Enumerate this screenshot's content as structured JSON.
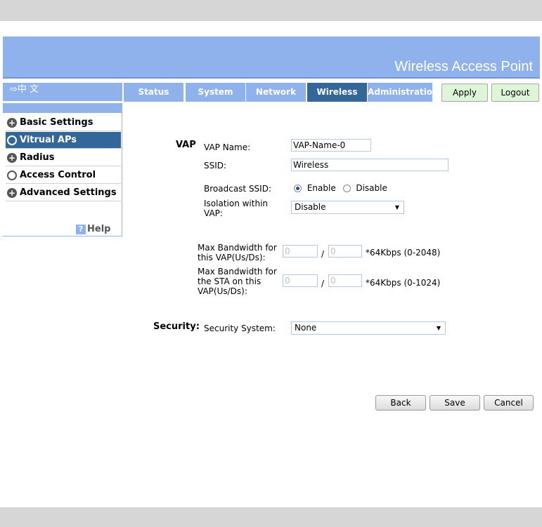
{
  "header": {
    "title": "Wireless Access Point",
    "lang_toggle": "⇨中 文"
  },
  "tabs": [
    {
      "label": "Status"
    },
    {
      "label": "System"
    },
    {
      "label": "Network"
    },
    {
      "label": "Wireless"
    },
    {
      "label": "Administration"
    }
  ],
  "actions": {
    "apply": "Apply",
    "logout": "Logout"
  },
  "sidebar": {
    "items": [
      {
        "label": "Basic Settings",
        "icon": "plus-icon"
      },
      {
        "label": "Vitrual APs",
        "icon": "circle-icon"
      },
      {
        "label": "Radius",
        "icon": "plus-icon"
      },
      {
        "label": "Access Control",
        "icon": "circle-icon"
      },
      {
        "label": "Advanced Settings",
        "icon": "plus-icon"
      }
    ],
    "help": "Help"
  },
  "vap": {
    "section": "VAP",
    "name_label": "VAP Name:",
    "name_value": "VAP-Name-0",
    "ssid_label": "SSID:",
    "ssid_value": "Wireless",
    "broadcast_label": "Broadcast SSID:",
    "broadcast_enable": "Enable",
    "broadcast_disable": "Disable",
    "isolation_label_1": "Isolation within",
    "isolation_label_2": "VAP:",
    "isolation_value": "Disable"
  },
  "bandwidth": {
    "vap_label_1": "Max Bandwidth for",
    "vap_label_2": "this VAP(Us/Ds):",
    "vap_us": "0",
    "vap_ds": "0",
    "vap_unit": "*64Kbps (0-2048)",
    "sta_label_1": "Max Bandwidth for",
    "sta_label_2": "the STA on this",
    "sta_label_3": "VAP(Us/Ds):",
    "sta_us": "0",
    "sta_ds": "0",
    "sta_unit": "*64Kbps (0-1024)",
    "slash": "/"
  },
  "security": {
    "section": "Security:",
    "system_label": "Security System:",
    "system_value": "None"
  },
  "footer": {
    "back": "Back",
    "save": "Save",
    "cancel": "Cancel"
  },
  "colors": {
    "banner": "#8fb2ec",
    "active_tab": "#336699",
    "button_green": "#dff5d8"
  }
}
